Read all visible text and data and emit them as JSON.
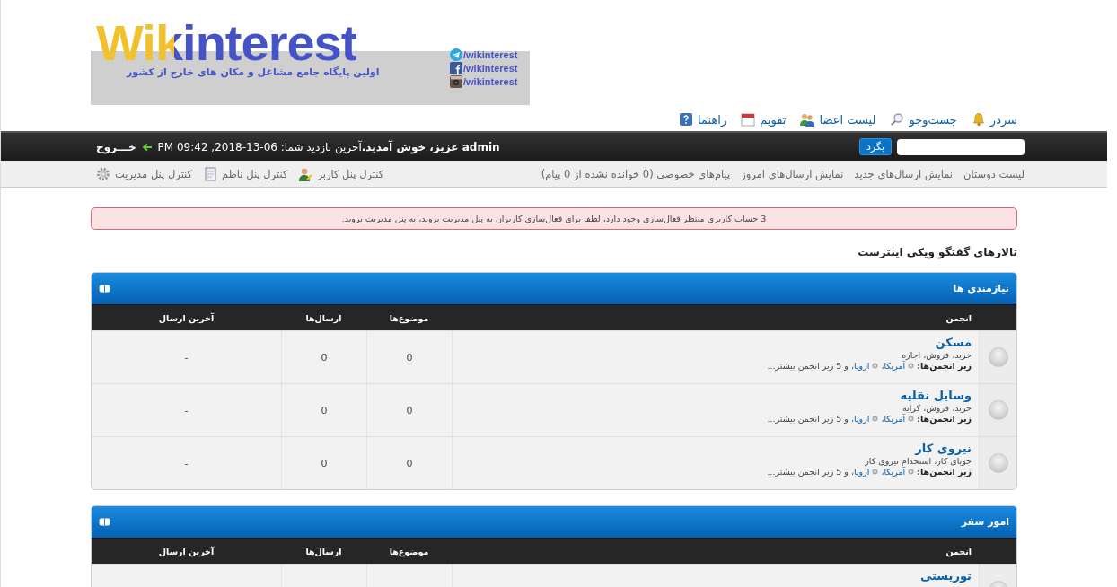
{
  "logo": {
    "text": "Wikinterest",
    "tagline": "اولین پایگاه جامع مشاغل و مکان های خارج از کشور",
    "social": [
      {
        "kind": "telegram",
        "label": "/wikinterest"
      },
      {
        "kind": "facebook",
        "label": "/wikinterest"
      },
      {
        "kind": "instagram",
        "label": "/wikinterest"
      }
    ]
  },
  "top_nav": [
    {
      "kind": "bell",
      "label": "سردر"
    },
    {
      "kind": "search",
      "label": "جست‌وجو"
    },
    {
      "kind": "members",
      "label": "لیست اعضا"
    },
    {
      "kind": "calendar",
      "label": "تقویم"
    },
    {
      "kind": "help",
      "label": "راهنما"
    }
  ],
  "user_bar": {
    "search_button": "بگرد",
    "welcome": "**admin عزیز، خوش آمدید.**آخرین بازدید شما: 06-13-2018, 09:42 PM",
    "logout": "خـــروج"
  },
  "sub_nav": {
    "links": [
      "لیست دوستان",
      "نمایش ارسال‌های جدید",
      "نمایش ارسال‌های امروز",
      "پیام‌های خصوصی (0 خوانده نشده از 0 پیام)"
    ],
    "panels": [
      {
        "kind": "user",
        "label": "کنترل پنل کاربر"
      },
      {
        "kind": "moderator",
        "label": "کنترل پنل ناظم"
      },
      {
        "kind": "admin",
        "label": "کنترل پنل مدیریت"
      }
    ]
  },
  "alert": "3 حساب کاربری منتظر فعال‌سازی وجود دارد، لطفا برای فعال‌سازی کاربران به پنل مدیریت بروید، به پنل مدیریت بروید.",
  "page_title": "تالارهای گفتگو ویکی اینترست",
  "categories": [
    {
      "title": "نیازمندی ها",
      "columns": [
        "انجمن",
        "موضوع‌ها",
        "ارسال‌ها",
        "آخرین ارسال"
      ],
      "forums": [
        {
          "name": "مسکن",
          "unread": false,
          "description": "خرید، فروش، اجاره",
          "subforums_label": "زیر انجمن‌ها:",
          "subforums": [
            "آمریکا،",
            "اروپا،"
          ],
          "more": "و 5 زیر انجمن بیشتر...",
          "topics": "0",
          "posts": "0",
          "last_post": "-"
        },
        {
          "name": "وسایل نقلیه",
          "unread": false,
          "description": "خرید، فروش، کرایه",
          "subforums_label": "زیر انجمن‌ها:",
          "subforums": [
            "آمریکا،",
            "اروپا،"
          ],
          "more": "و 5 زیر انجمن بیشتر...",
          "topics": "0",
          "posts": "0",
          "last_post": "-"
        },
        {
          "name": "نیروی کار",
          "unread": false,
          "description": "جویای کار، استخدام نیروی کار",
          "subforums_label": "زیر انجمن‌ها:",
          "subforums": [
            "آمریکا،",
            "اروپا،"
          ],
          "more": "و 5 زیر انجمن بیشتر...",
          "topics": "0",
          "posts": "0",
          "last_post": "-"
        }
      ]
    },
    {
      "title": "امور سفر",
      "columns": [
        "انجمن",
        "موضوع‌ها",
        "ارسال‌ها",
        "آخرین ارسال"
      ],
      "forums": [
        {
          "name": "توریستی",
          "unread": false
        }
      ]
    }
  ]
}
